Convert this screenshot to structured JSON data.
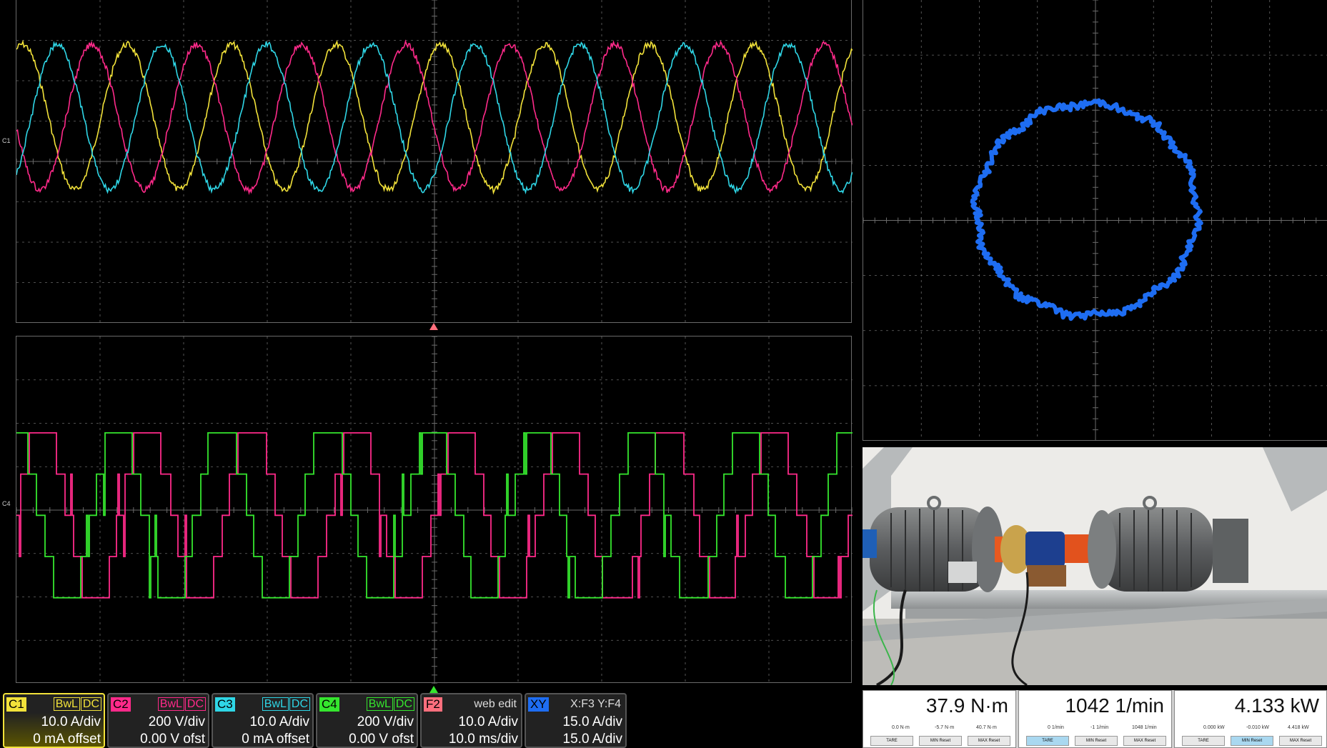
{
  "colors": {
    "c1": "#f2e23a",
    "c2": "#ff2a8a",
    "c3": "#2fd6e6",
    "c4": "#35e62e",
    "f2": "#ff6f7d",
    "xy": "#1e6df2",
    "grid": "#6a6a6a"
  },
  "chart_data": [
    {
      "type": "line",
      "panel": "top",
      "series": [
        {
          "channel": "C1",
          "shape": "three-phase sine, phase 0"
        },
        {
          "channel": "C2",
          "shape": "three-phase sine, phase +120°"
        },
        {
          "channel": "C3",
          "shape": "three-phase sine, phase -120°"
        }
      ],
      "periods": 8,
      "amplitude_div": 1.8
    },
    {
      "type": "line",
      "panel": "bottom",
      "series": [
        {
          "channel": "C2",
          "shape": "multilevel PWM voltage"
        },
        {
          "channel": "C4",
          "shape": "multilevel PWM voltage"
        }
      ],
      "periods": 8
    },
    {
      "type": "scatter",
      "panel": "xy",
      "label": "X:F3 Y:F4",
      "shape": "circle",
      "center": [
        0,
        0
      ],
      "radius_div": 1.9
    }
  ],
  "channel_labels": {
    "top": "C1",
    "bottom": "C4"
  },
  "descriptors": [
    {
      "tag": "C1",
      "flags": [
        "BwL",
        "DC"
      ],
      "line1": "10.0 A/div",
      "line2": "0 mA offset",
      "color": "#f2e23a"
    },
    {
      "tag": "C2",
      "flags": [
        "BwL",
        "DC"
      ],
      "line1": "200 V/div",
      "line2": "0.00 V ofst",
      "color": "#ff2a8a"
    },
    {
      "tag": "C3",
      "flags": [
        "BwL",
        "DC"
      ],
      "line1": "10.0 A/div",
      "line2": "0 mA offset",
      "color": "#2fd6e6"
    },
    {
      "tag": "C4",
      "flags": [
        "BwL",
        "DC"
      ],
      "line1": "200 V/div",
      "line2": "0.00 V ofst",
      "color": "#35e62e"
    },
    {
      "tag": "F2",
      "flags": [
        "web edit"
      ],
      "line1": "10.0 A/div",
      "line2": "10.0 ms/div",
      "color": "#ff6f7d"
    },
    {
      "tag": "XY",
      "flags": [
        "X:F3 Y:F4"
      ],
      "line1": "15.0 A/div",
      "line2": "15.0 A/div",
      "color": "#1e6df2"
    }
  ],
  "meter": [
    {
      "value": "37.9 N·m",
      "subs": [
        "0.0 N·m",
        "-5.7 N·m",
        "40.7 N·m"
      ],
      "buttons": [
        "TARE",
        "MIN Reset",
        "MAX Reset"
      ]
    },
    {
      "value": "1042 1/min",
      "subs": [
        "0 1/min",
        "-1 1/min",
        "1048 1/min"
      ],
      "buttons": [
        "TARE",
        "MIN Reset",
        "MAX Reset"
      ]
    },
    {
      "value": "4.133 kW",
      "subs": [
        "0.000 kW",
        "-0.010 kW",
        "4.418 kW"
      ],
      "buttons": [
        "TARE",
        "MIN Reset",
        "MAX Reset"
      ]
    }
  ]
}
